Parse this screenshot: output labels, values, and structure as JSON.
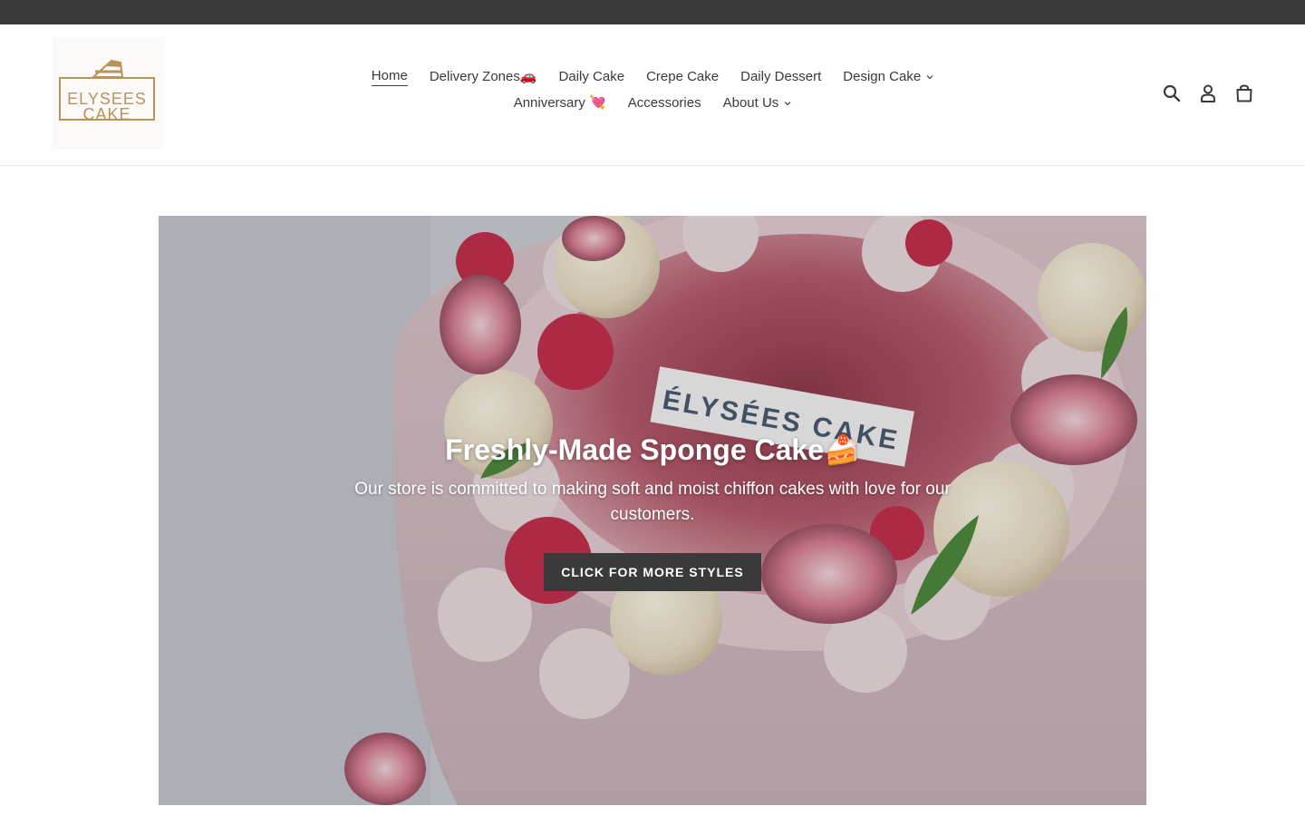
{
  "brand": {
    "logo_line1": "ELYSEES",
    "logo_line2": "CAKE",
    "logo_color": "#b8945a"
  },
  "nav": {
    "row1": [
      {
        "label": "Home",
        "active": true,
        "dropdown": false
      },
      {
        "label": "Delivery Zones🚗",
        "active": false,
        "dropdown": false
      },
      {
        "label": "Daily Cake",
        "active": false,
        "dropdown": false
      },
      {
        "label": "Crepe Cake",
        "active": false,
        "dropdown": false
      },
      {
        "label": "Daily Dessert",
        "active": false,
        "dropdown": false
      },
      {
        "label": "Design Cake",
        "active": false,
        "dropdown": true
      }
    ],
    "row2": [
      {
        "label": "Anniversary 💘",
        "active": false,
        "dropdown": false
      },
      {
        "label": "Accessories",
        "active": false,
        "dropdown": false
      },
      {
        "label": "About Us",
        "active": false,
        "dropdown": true
      }
    ]
  },
  "header_icons": [
    "search-icon",
    "account-icon",
    "cart-icon"
  ],
  "hero": {
    "title": "Freshly-Made Sponge Cake🍰",
    "subtitle": "Our store is committed to making soft and moist chiffon cakes with love for our customers.",
    "button_label": "CLICK FOR MORE STYLES",
    "cake_topper_text": "ÉLYSÉES CAKE"
  },
  "colors": {
    "topbar": "#3a3a3a",
    "text": "#3a3a3a",
    "button_bg": "#3a3a3a",
    "button_text": "#ffffff"
  }
}
